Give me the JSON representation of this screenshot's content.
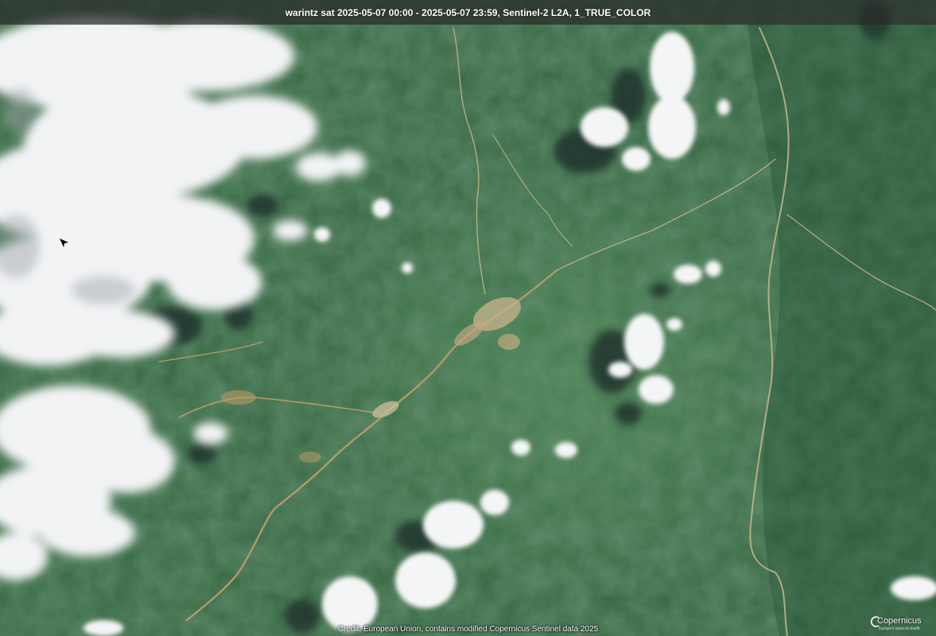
{
  "title": "warintz sat 2025-05-07 00:00 - 2025-05-07 23:59, Sentinel-2 L2A, 1_TRUE_COLOR",
  "credit": "Credit: European Union, contains modified Copernicus Sentinel data 2025",
  "logo": {
    "text": "Copernicus",
    "subtext": "Europe's eyes on Earth"
  },
  "colors": {
    "forest_dark": "#244a2f",
    "forest_mid": "#33653f",
    "forest_light": "#4a8050",
    "cloud": "#f2f3f5",
    "cloud_shadow": "#1c2f2a",
    "road": "#b59a6a",
    "settlement": "#c8b48c"
  }
}
